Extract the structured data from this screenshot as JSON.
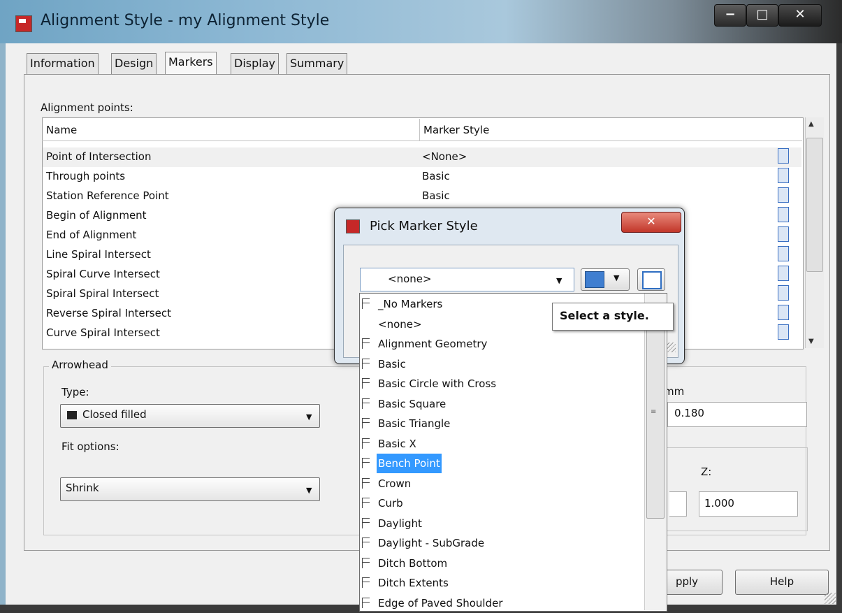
{
  "window": {
    "title": "Alignment Style - my Alignment Style",
    "minimize": "−",
    "maximize": "□",
    "close": "✕"
  },
  "tabs": [
    {
      "label": "Information"
    },
    {
      "label": "Design"
    },
    {
      "label": "Markers",
      "active": true
    },
    {
      "label": "Display"
    },
    {
      "label": "Summary"
    }
  ],
  "alignment_points": {
    "label": "Alignment points:",
    "columns": {
      "name": "Name",
      "marker_style": "Marker Style"
    },
    "rows": [
      {
        "name": "Point of Intersection",
        "style": "<None>"
      },
      {
        "name": "Through points",
        "style": "Basic"
      },
      {
        "name": "Station Reference Point",
        "style": "Basic"
      },
      {
        "name": "Begin of Alignment",
        "style": ""
      },
      {
        "name": "End of Alignment",
        "style": ""
      },
      {
        "name": "Line Spiral Intersect",
        "style": ""
      },
      {
        "name": "Spiral Curve Intersect",
        "style": ""
      },
      {
        "name": "Spiral Spiral Intersect",
        "style": ""
      },
      {
        "name": "Reverse Spiral Intersect",
        "style": ""
      },
      {
        "name": "Curve Spiral Intersect",
        "style": ""
      }
    ]
  },
  "arrowhead": {
    "group_label": "Arrowhead",
    "type_label": "Type:",
    "type_value": "Closed filled",
    "fit_label": "Fit options:",
    "fit_value": "Shrink",
    "size_unit": "mm",
    "size_value": "0.180",
    "z_label": "Z:",
    "z_value": "1.000"
  },
  "buttons": {
    "apply": "pply",
    "help": "Help"
  },
  "pick_dialog": {
    "title": "Pick Marker Style",
    "close": "✕",
    "selected": "<none>",
    "tooltip": "Select a style.",
    "items": [
      {
        "label": "_No Markers",
        "icon": true
      },
      {
        "label": "<none>",
        "icon": false
      },
      {
        "label": "Alignment Geometry",
        "icon": true
      },
      {
        "label": "Basic",
        "icon": true
      },
      {
        "label": "Basic Circle with Cross",
        "icon": true
      },
      {
        "label": "Basic Square",
        "icon": true
      },
      {
        "label": "Basic Triangle",
        "icon": true
      },
      {
        "label": "Basic X",
        "icon": true
      },
      {
        "label": "Bench Point",
        "icon": true,
        "highlighted": true
      },
      {
        "label": "Crown",
        "icon": true
      },
      {
        "label": "Curb",
        "icon": true
      },
      {
        "label": "Daylight",
        "icon": true
      },
      {
        "label": "Daylight - SubGrade",
        "icon": true
      },
      {
        "label": "Ditch Bottom",
        "icon": true
      },
      {
        "label": "Ditch Extents",
        "icon": true
      },
      {
        "label": "Edge of Paved Shoulder",
        "icon": true
      }
    ]
  },
  "colors": {
    "selection": "#3399ff",
    "close_red": "#c2362a",
    "title_blue": "#8db8d4"
  }
}
